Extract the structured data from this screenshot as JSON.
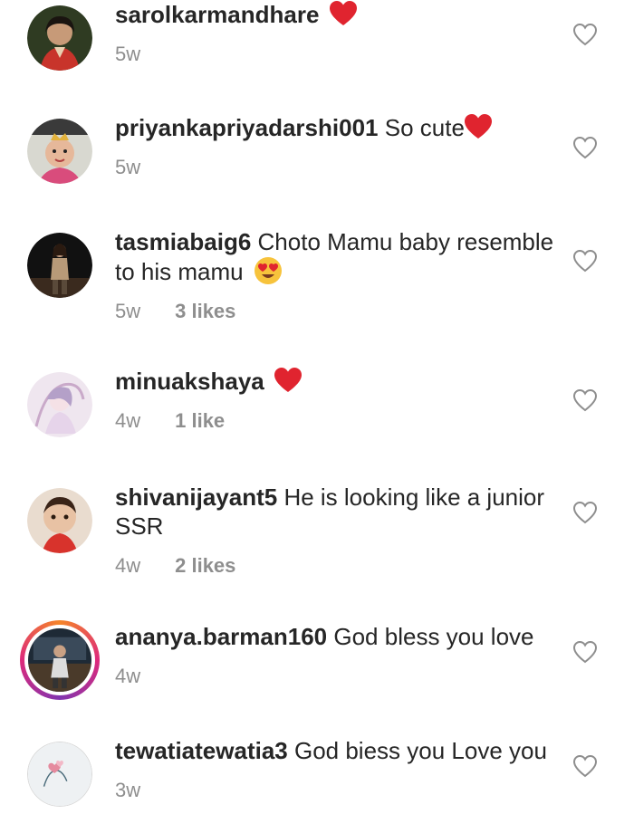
{
  "comments": [
    {
      "username": "sarolkarmandhare",
      "text": "",
      "emoji": "red-heart",
      "time": "5w",
      "likes": ""
    },
    {
      "username": "priyankapriyadarshi001",
      "text": "So cute",
      "emoji": "red-heart",
      "time": "5w",
      "likes": ""
    },
    {
      "username": "tasmiabaig6",
      "text": "Choto Mamu  baby resemble to his mamu",
      "emoji": "heart-eyes",
      "time": "5w",
      "likes": "3 likes"
    },
    {
      "username": "minuakshaya",
      "text": "",
      "emoji": "red-heart",
      "time": "4w",
      "likes": "1 like"
    },
    {
      "username": "shivanijayant5",
      "text": "He is looking like a junior SSR",
      "emoji": "",
      "time": "4w",
      "likes": "2 likes"
    },
    {
      "username": "ananya.barman160",
      "text": "God bless you love",
      "emoji": "",
      "time": "4w",
      "likes": ""
    },
    {
      "username": "tewatiatewatia3",
      "text": "God biess you Love you",
      "emoji": "",
      "time": "3w",
      "likes": ""
    }
  ],
  "colors": {
    "text": "#262626",
    "muted": "#8e8e8e",
    "heart": "#ed4956"
  },
  "icons": {
    "like": "heart-outline-icon",
    "inline_heart": "red-heart-emoji",
    "heart_eyes": "heart-eyes-emoji"
  }
}
